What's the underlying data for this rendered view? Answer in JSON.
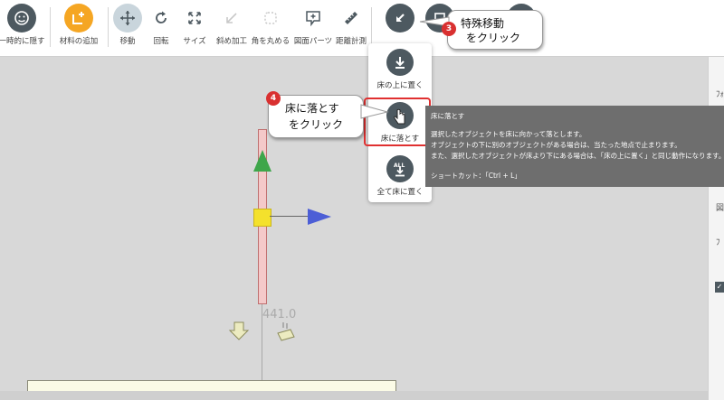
{
  "toolbar": {
    "hide": "一時的に隠す",
    "add_material": "材料の追加",
    "move": "移動",
    "rotate": "回転",
    "size": "サイズ",
    "bevel": "斜め加工",
    "round": "角を丸める",
    "parts": "図面パーツ",
    "measure": "距離計測"
  },
  "dropdown": {
    "place_on_floor": "床の上に置く",
    "drop_to_floor": "床に落とす",
    "place_all": "全て床に置く"
  },
  "tooltip": {
    "title": "床に落とす",
    "line1": "選択したオブジェクトを床に向かって落とします。",
    "line2": "オブジェクトの下に別のオブジェクトがある場合は、当たった地点で止まります。",
    "line3": "また、選択したオブジェクトが床より下にある場合は、「床の上に置く」と同じ動作になります。",
    "shortcut": "ショートカット：「Ctrl + L」"
  },
  "callouts": {
    "step3_number": "3",
    "step3_line1": "特殊移動",
    "step3_line2": "をクリック",
    "step4_number": "4",
    "step4_line1": "床に落とす",
    "step4_line2": "をクリック"
  },
  "viewport": {
    "dimension": "441.0"
  },
  "right_panel": {
    "t1": "ﾌｫ",
    "t2": "図",
    "t3": "ﾌ"
  },
  "colors": {
    "accent_dark": "#4d5960",
    "accent_orange": "#f5a623",
    "highlight_red": "#e03030"
  }
}
